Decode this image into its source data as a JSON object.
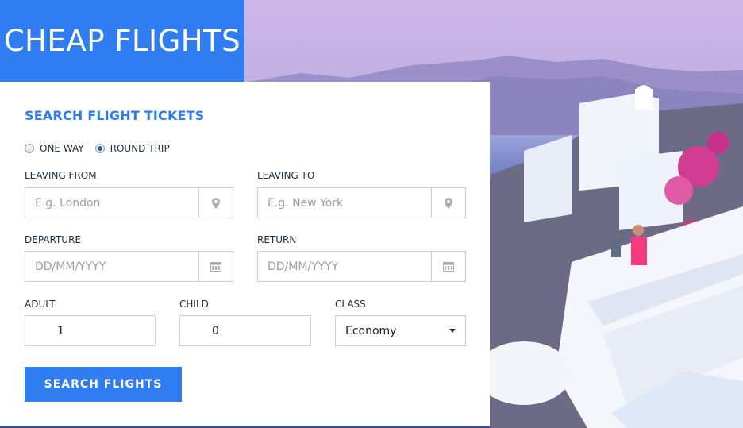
{
  "header": {
    "title": "CHEAP FLIGHTS"
  },
  "form": {
    "heading": "SEARCH FLIGHT TICKETS",
    "trip_type": {
      "options": [
        {
          "label": "ONE WAY",
          "selected": false
        },
        {
          "label": "ROUND TRIP",
          "selected": true
        }
      ]
    },
    "leaving_from": {
      "label": "LEAVING FROM",
      "placeholder": "E.g. London",
      "icon": "map-marker-icon"
    },
    "leaving_to": {
      "label": "LEAVING TO",
      "placeholder": "E.g. New York",
      "icon": "map-marker-icon"
    },
    "departure": {
      "label": "DEPARTURE",
      "placeholder": "DD/MM/YYYY",
      "icon": "calendar-icon"
    },
    "return": {
      "label": "RETURN",
      "placeholder": "DD/MM/YYYY",
      "icon": "calendar-icon"
    },
    "adult": {
      "label": "ADULT",
      "value": "1"
    },
    "child": {
      "label": "CHILD",
      "value": "0"
    },
    "class": {
      "label": "CLASS",
      "value": "Economy"
    },
    "submit_label": "SEARCH FLIGHTS"
  },
  "colors": {
    "accent": "#2f7df0",
    "heading": "#2f7df0",
    "border": "#c9ced4"
  }
}
